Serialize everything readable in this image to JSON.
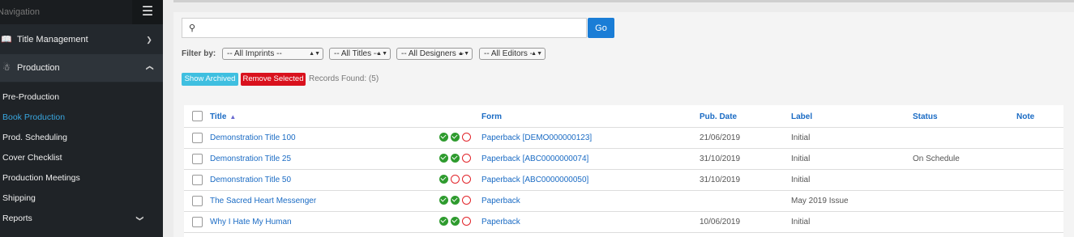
{
  "sidebar": {
    "title": "Navigation",
    "sections": [
      {
        "label": "Title Management",
        "icon": "book-icon",
        "chevron": "chevron-down"
      },
      {
        "label": "Production",
        "icon": "users-icon",
        "chevron": "chevron-up"
      }
    ],
    "production_items": [
      {
        "label": "Pre-Production"
      },
      {
        "label": "Book Production",
        "active": true
      },
      {
        "label": "Prod. Scheduling"
      },
      {
        "label": "Cover Checklist"
      },
      {
        "label": "Production Meetings"
      },
      {
        "label": "Shipping"
      },
      {
        "label": "Reports",
        "chevron": "chevron-down"
      }
    ]
  },
  "search": {
    "value": "",
    "go_label": "Go"
  },
  "filters": {
    "label": "Filter by:",
    "imprints": "-- All Imprints --",
    "titles": "-- All Titles --",
    "designers": "-- All Designers --",
    "editors": "-- All Editors --"
  },
  "actions": {
    "show_archived": "Show Archived",
    "remove_selected": "Remove Selected",
    "records_found": "Records Found: (5)"
  },
  "table": {
    "columns": {
      "title": "Title",
      "form": "Form",
      "pub_date": "Pub. Date",
      "label": "Label",
      "status": "Status",
      "note": "Note"
    },
    "sort_indicator": "▲",
    "rows": [
      {
        "title": "Demonstration Title 100",
        "checks": [
          "ok",
          "ok",
          "no"
        ],
        "form": "Paperback [DEMO000000123]",
        "pub_date": "21/06/2019",
        "label": "Initial",
        "status": "",
        "note": ""
      },
      {
        "title": "Demonstration Title 25",
        "checks": [
          "ok",
          "ok",
          "no"
        ],
        "form": "Paperback [ABC0000000074]",
        "pub_date": "31/10/2019",
        "label": "Initial",
        "status": "On Schedule",
        "note": ""
      },
      {
        "title": "Demonstration Title 50",
        "checks": [
          "ok",
          "no",
          "no"
        ],
        "form": "Paperback [ABC0000000050]",
        "pub_date": "31/10/2019",
        "label": "Initial",
        "status": "",
        "note": ""
      },
      {
        "title": "The Sacred Heart Messenger",
        "checks": [
          "ok",
          "ok",
          "no"
        ],
        "form": "Paperback",
        "pub_date": "",
        "label": "May 2019 Issue",
        "status": "",
        "note": ""
      },
      {
        "title": "Why I Hate My Human",
        "checks": [
          "ok",
          "ok",
          "no"
        ],
        "form": "Paperback",
        "pub_date": "10/06/2019",
        "label": "Initial",
        "status": "",
        "note": ""
      }
    ]
  },
  "colors": {
    "sidebar_bg": "#23282d",
    "accent_blue": "#1a7dd6",
    "link_blue": "#1a6bc4",
    "show_archived_bg": "#3fbfe0",
    "remove_bg": "#d9111d",
    "check_green": "#2e9b2e",
    "pending_red": "#e2242a"
  }
}
